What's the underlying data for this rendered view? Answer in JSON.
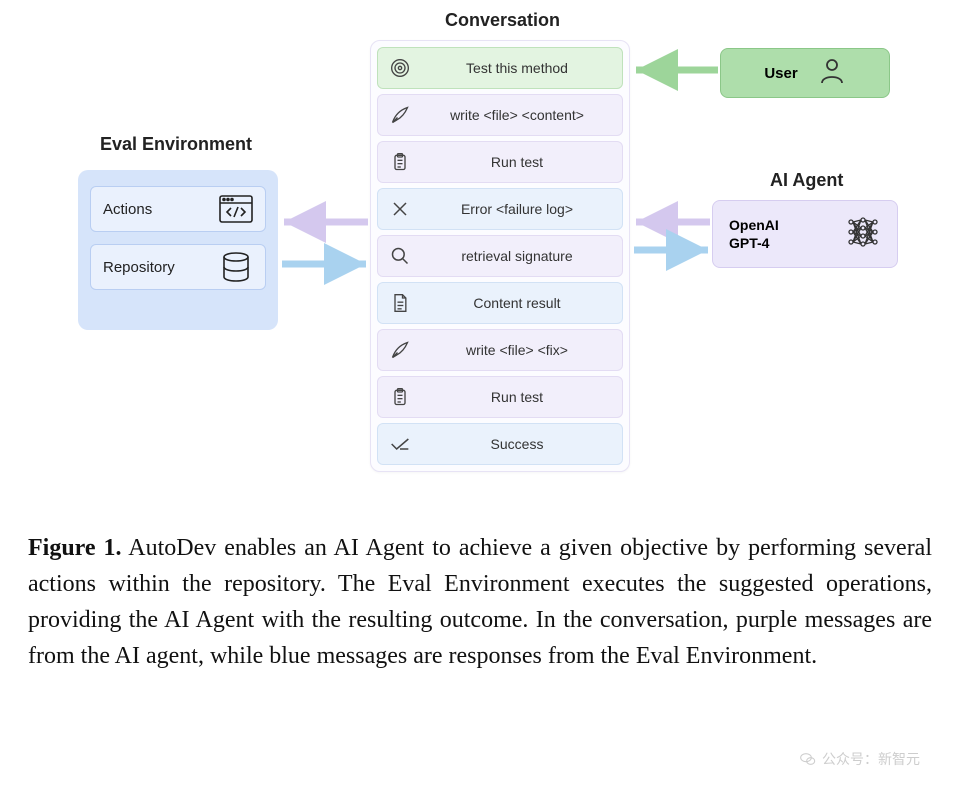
{
  "labels": {
    "eval_env": "Eval Environment",
    "conversation": "Conversation",
    "ai_agent": "AI Agent"
  },
  "eval_env": {
    "actions": "Actions",
    "repository": "Repository"
  },
  "conversation": [
    {
      "icon": "target-icon",
      "text": "Test this method",
      "color": "green"
    },
    {
      "icon": "quill-icon",
      "text": "write <file> <content>",
      "color": "purple"
    },
    {
      "icon": "clipboard-icon",
      "text": "Run test",
      "color": "purple"
    },
    {
      "icon": "x-icon",
      "text": "Error <failure log>",
      "color": "blue"
    },
    {
      "icon": "search-icon",
      "text": "retrieval signature",
      "color": "purple"
    },
    {
      "icon": "document-icon",
      "text": "Content result",
      "color": "blue"
    },
    {
      "icon": "quill-icon",
      "text": "write <file> <fix>",
      "color": "purple"
    },
    {
      "icon": "clipboard-icon",
      "text": "Run test",
      "color": "purple"
    },
    {
      "icon": "check-icon",
      "text": "Success",
      "color": "blue"
    }
  ],
  "user": {
    "label": "User"
  },
  "agent": {
    "label": "OpenAI\nGPT-4"
  },
  "caption": {
    "label": "Figure 1.",
    "text": "AutoDev enables an AI Agent to achieve a given objective by performing several actions within the repository. The Eval Environment executes the suggested operations, providing the AI Agent with the resulting outcome. In the conversation, purple messages are from the AI agent, while blue messages are responses from the Eval Environment."
  },
  "watermark": "公众号：新智元",
  "colors": {
    "green_arrow": "#9dd59a",
    "purple_arrow": "#d4c8ee",
    "blue_arrow": "#a9d2ef"
  }
}
